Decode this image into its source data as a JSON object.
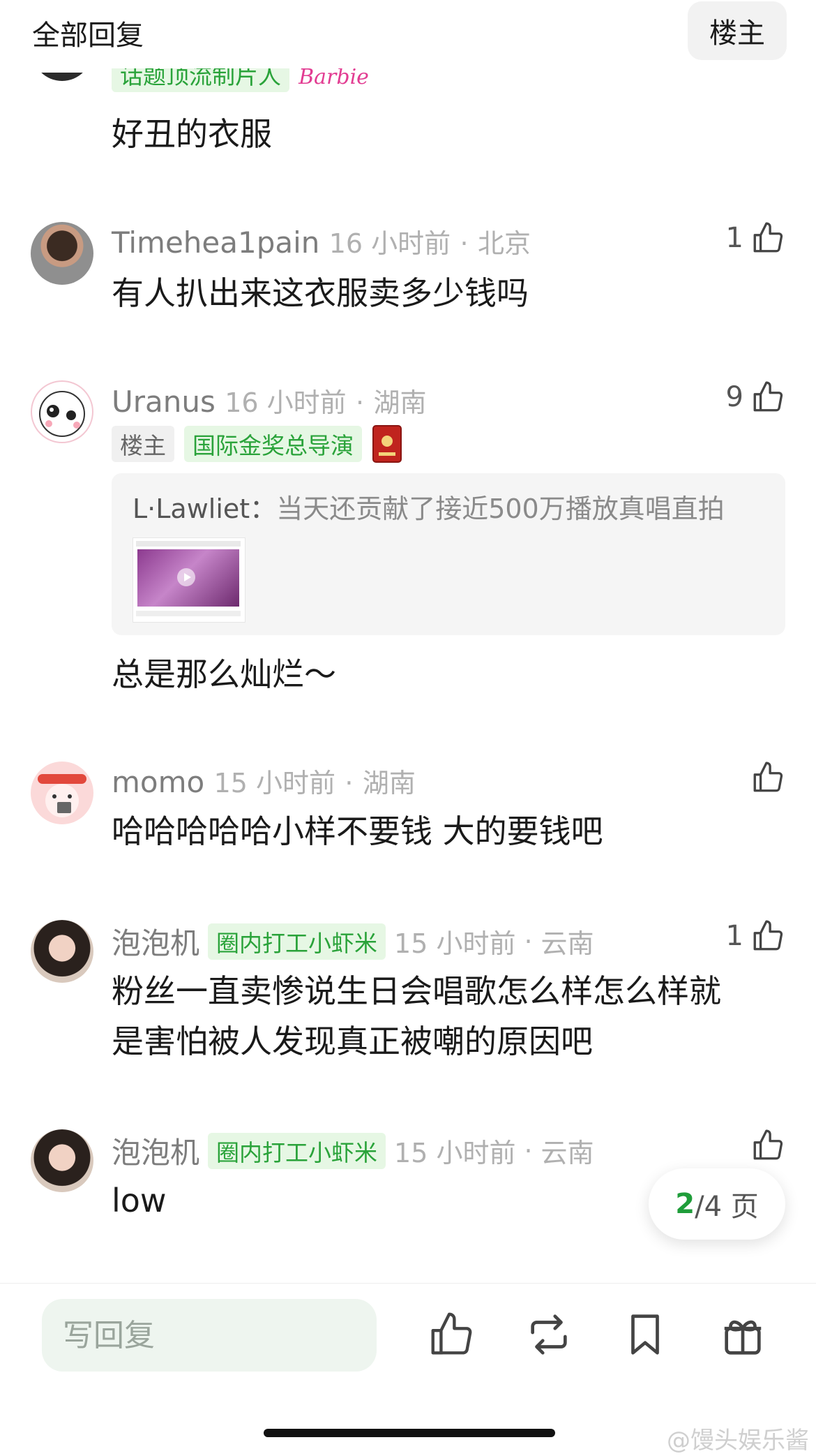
{
  "header": {
    "title": "全部回复",
    "owner_button": "楼主"
  },
  "comments": [
    {
      "badge_green": "话题顶流制片人",
      "badge_brand": "Barbie",
      "text": "好丑的衣服"
    },
    {
      "username": "Timehea1pain",
      "time": "16 小时前",
      "location": "北京",
      "likes": "1",
      "text": "有人扒出来这衣服卖多少钱吗"
    },
    {
      "username": "Uranus",
      "time": "16 小时前",
      "location": "湖南",
      "likes": "9",
      "badge_owner": "楼主",
      "badge_green": "国际金奖总导演",
      "quote_author": "L·Lawliet：",
      "quote_text": "当天还贡献了接近500万播放真唱直拍",
      "text": "总是那么灿烂～"
    },
    {
      "username": "momo",
      "time": "15 小时前",
      "location": "湖南",
      "likes": "",
      "text": "哈哈哈哈哈小样不要钱 大的要钱吧"
    },
    {
      "username": "泡泡机",
      "badge_green": "圈内打工小虾米",
      "time": "15 小时前",
      "location": "云南",
      "likes": "1",
      "text_line1": "粉丝一直卖惨说生日会唱歌怎么样怎么样就",
      "text_line2": "是害怕被人发现真正被嘲的原因吧"
    },
    {
      "username": "泡泡机",
      "badge_green": "圈内打工小虾米",
      "time": "15 小时前",
      "location": "云南",
      "likes": "",
      "text": "low"
    }
  ],
  "separator": "·",
  "pagination": {
    "current": "2",
    "total_text": "/4 页"
  },
  "bottom_bar": {
    "reply_placeholder": "写回复"
  },
  "watermark": "@馒头娱乐酱",
  "colors": {
    "accent_green": "#2aa33a",
    "badge_green_bg": "#e6f7e4"
  }
}
